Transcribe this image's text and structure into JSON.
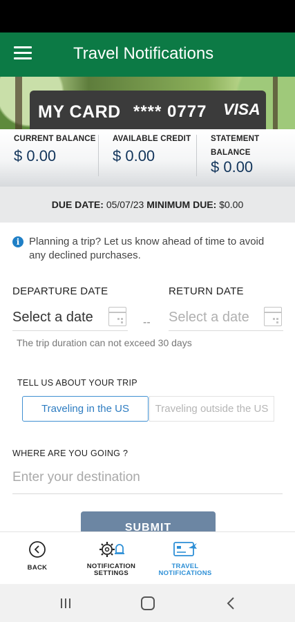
{
  "header": {
    "title": "Travel Notifications",
    "menu_icon": "hamburger-menu-icon",
    "bar_color": "#0c7a45"
  },
  "card": {
    "name": "MY CARD",
    "masked_number": "**** 0777",
    "brand": "VISA"
  },
  "balances": [
    {
      "label": "CURRENT BALANCE",
      "value": "$ 0.00"
    },
    {
      "label": "AVAILABLE CREDIT",
      "value": "$ 0.00"
    },
    {
      "label_line1": "STATEMENT",
      "label_line2": "BALANCE",
      "value": "$ 0.00"
    }
  ],
  "due": {
    "due_date_label": "DUE DATE:",
    "due_date_value": "05/07/23",
    "min_due_label": "MINIMUM DUE:",
    "min_due_value": "$0.00"
  },
  "info": {
    "icon": "info-icon",
    "text": "Planning a trip? Let us know ahead of time to avoid any declined purchases."
  },
  "dates": {
    "departure_label": "DEPARTURE DATE",
    "departure_placeholder": "Select a date",
    "separator": "--",
    "return_label": "RETURN DATE",
    "return_placeholder": "Select a date",
    "hint": "The trip duration can not exceed 30 days"
  },
  "trip_type": {
    "label": "TELL US ABOUT YOUR TRIP",
    "options": [
      "Traveling in the US",
      "Traveling outside the US"
    ],
    "selected": "Traveling in the US",
    "accent_color": "#3f8fd1"
  },
  "destination": {
    "label": "WHERE ARE YOU GOING ?",
    "placeholder": "Enter your destination"
  },
  "submit_label": "SUBMIT",
  "bottom_nav": [
    {
      "label": "BACK",
      "icon": "back-circle-icon"
    },
    {
      "label_line1": "NOTIFICATION",
      "label_line2": "SETTINGS",
      "icon": "gear-bell-icon"
    },
    {
      "label_line1": "TRAVEL",
      "label_line2": "NOTIFICATIONS",
      "icon": "card-plane-icon",
      "active": true
    }
  ],
  "system_nav": {
    "recents_icon": "recents-icon",
    "home_icon": "home-icon",
    "back_icon": "back-chevron-icon"
  }
}
